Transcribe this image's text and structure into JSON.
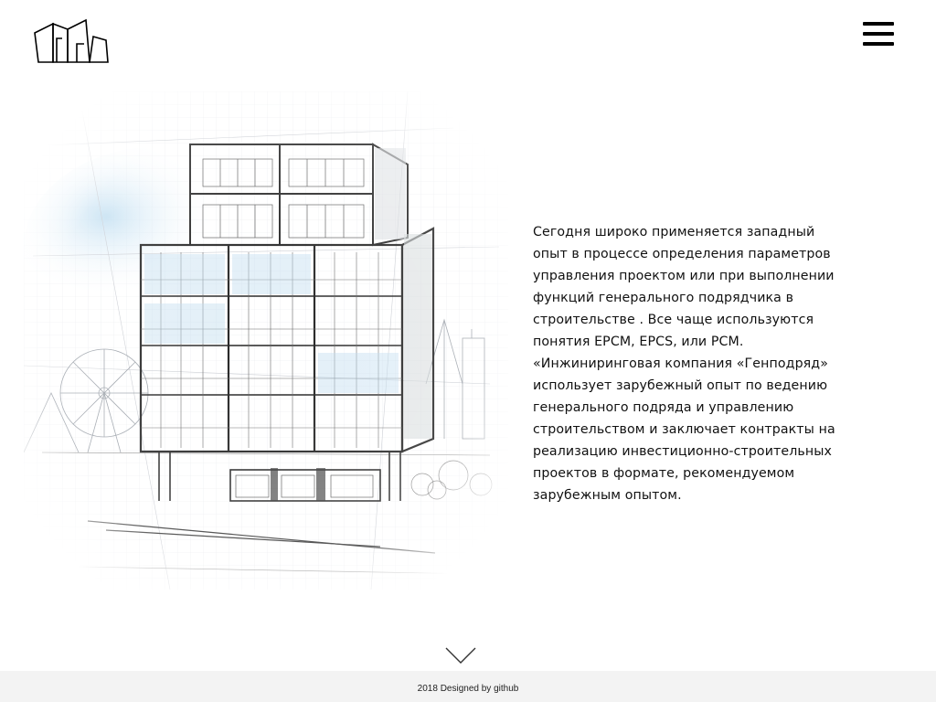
{
  "header": {
    "logo_icon": "building-outline-logo",
    "menu_icon": "hamburger-menu-icon"
  },
  "hero": {
    "illustration_icon": "building-sketch-illustration",
    "text_lines": [
      "Сегодня широко применяется западный",
      "опыт в процессе определения параметров",
      "управления проектом или при выполнении",
      "функций генерального подрядчика в",
      "строительстве . Все чаще используются",
      "понятия EPCM, EPCS, или PCM.",
      "«Инжиниринговая компания «Генподряд»",
      "использует зарубежный опыт по ведению",
      "генерального подряда и управлению",
      "строительством и заключает контракты на",
      "реализацию инвестиционно-строительных",
      "проектов в формате, рекомендуемом",
      "зарубежным опытом."
    ]
  },
  "scroll": {
    "icon": "chevron-down-icon"
  },
  "footer": {
    "text": "2018 Designed by github"
  }
}
